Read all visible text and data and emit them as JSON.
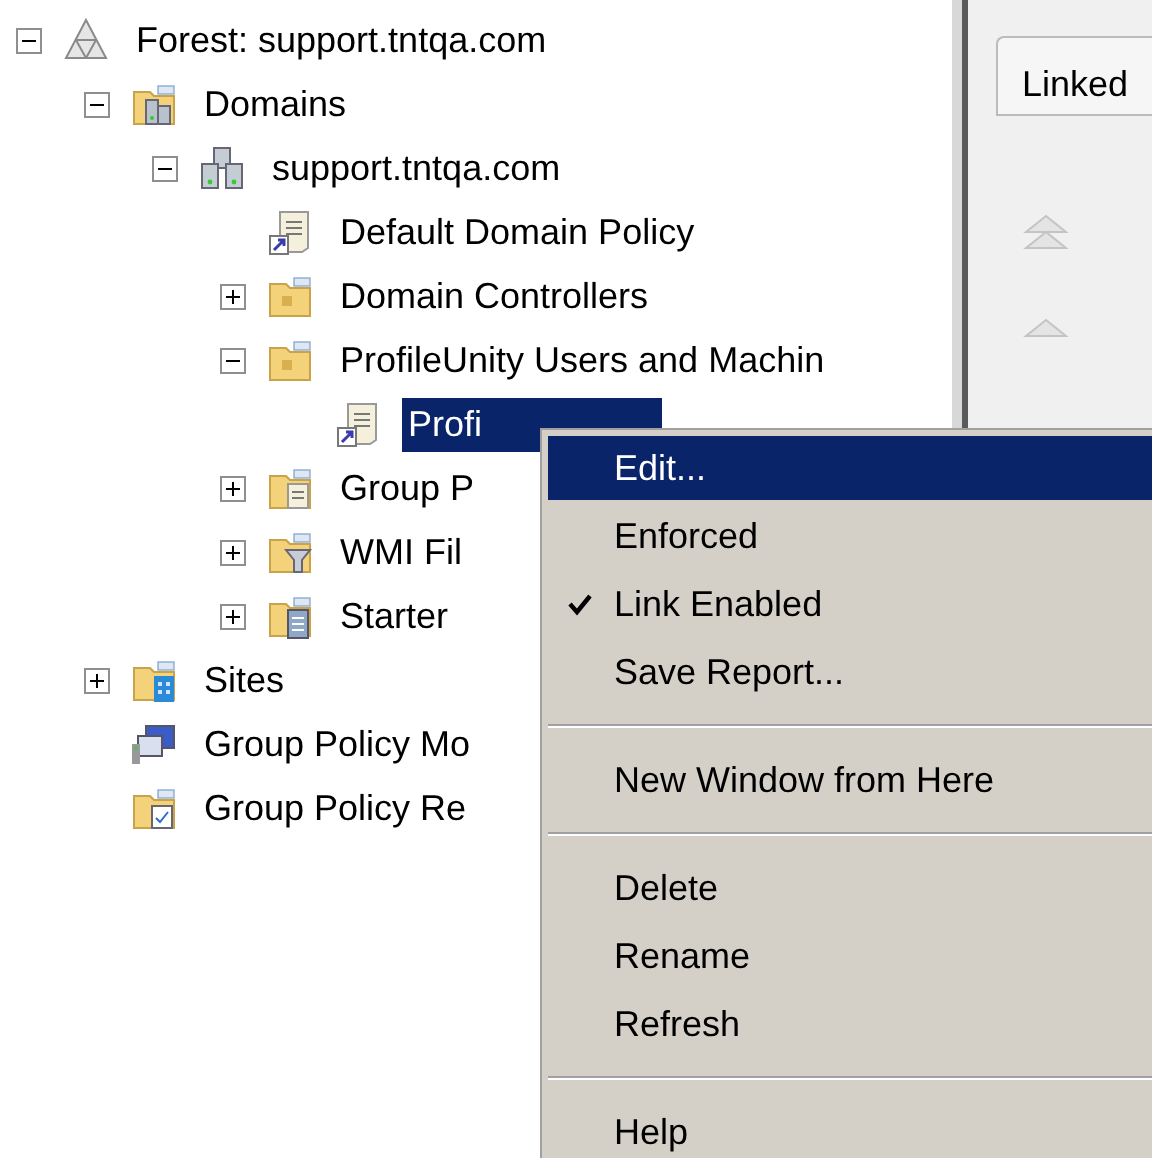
{
  "tree": [
    {
      "label": "Forest: support.tntqa.com",
      "kind": "forest",
      "expanded": true,
      "selected": false,
      "children": [
        {
          "label": "Domains",
          "kind": "domains",
          "expanded": true,
          "selected": false,
          "children": [
            {
              "label": "support.tntqa.com",
              "kind": "domain",
              "expanded": true,
              "selected": false,
              "children": [
                {
                  "label": "Default Domain Policy",
                  "kind": "gpo-link",
                  "selected": false
                },
                {
                  "label": "Domain Controllers",
                  "kind": "ou",
                  "expanded": false,
                  "selected": false
                },
                {
                  "label": "ProfileUnity Users and Machin",
                  "kind": "ou",
                  "expanded": true,
                  "selected": false,
                  "children": [
                    {
                      "label": "Profi",
                      "kind": "gpo-link",
                      "selected": true
                    }
                  ]
                },
                {
                  "label": "Group P",
                  "kind": "gpo-folder",
                  "expanded": false,
                  "selected": false
                },
                {
                  "label": "WMI Fil",
                  "kind": "wmi-folder",
                  "expanded": false,
                  "selected": false
                },
                {
                  "label": "Starter",
                  "kind": "starter-folder",
                  "expanded": false,
                  "selected": false
                }
              ]
            }
          ]
        },
        {
          "label": "Sites",
          "kind": "sites",
          "expanded": false,
          "selected": false
        },
        {
          "label": "Group Policy Mo",
          "kind": "modeling",
          "selected": false
        },
        {
          "label": "Group Policy Re",
          "kind": "results",
          "selected": false
        }
      ]
    }
  ],
  "right_panel": {
    "tab": "Linked"
  },
  "context_menu": [
    {
      "kind": "item",
      "label": "Edit...",
      "selected": true,
      "checked": false
    },
    {
      "kind": "item",
      "label": "Enforced",
      "selected": false,
      "checked": false
    },
    {
      "kind": "item",
      "label": "Link Enabled",
      "selected": false,
      "checked": true
    },
    {
      "kind": "item",
      "label": "Save Report...",
      "selected": false,
      "checked": false
    },
    {
      "kind": "separator"
    },
    {
      "kind": "item",
      "label": "New Window from Here",
      "selected": false,
      "checked": false
    },
    {
      "kind": "separator"
    },
    {
      "kind": "item",
      "label": "Delete",
      "selected": false,
      "checked": false
    },
    {
      "kind": "item",
      "label": "Rename",
      "selected": false,
      "checked": false
    },
    {
      "kind": "item",
      "label": "Refresh",
      "selected": false,
      "checked": false
    },
    {
      "kind": "separator"
    },
    {
      "kind": "item",
      "label": "Help",
      "selected": false,
      "checked": false
    }
  ]
}
